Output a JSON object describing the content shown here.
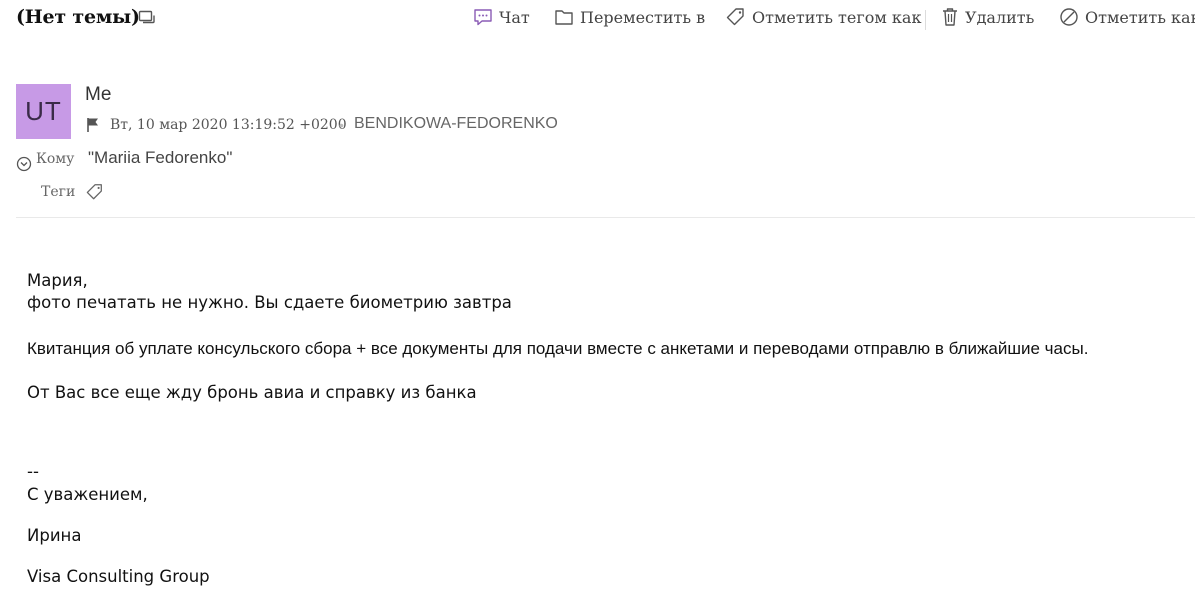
{
  "header": {
    "subject": "(Нет темы)",
    "thread_icon": "conversation-icon"
  },
  "toolbar": {
    "chat_label": "Чат",
    "move_label": "Переместить в",
    "tag_label": "Отметить тегом как",
    "delete_label": "Удалить",
    "mark_label": "Отметить как"
  },
  "message": {
    "avatar_initials": "UT",
    "avatar_color": "#c79ae6",
    "sender": "Me",
    "date": "Вт, 10 мар 2020 13:19:52 +0200",
    "separator": "•",
    "folder": "BENDIKOWA-FEDORENKO",
    "to_label": "Кому",
    "to_value": "\"Mariia Fedorenko\"",
    "tags_label": "Теги"
  },
  "body": {
    "line1": "Мария,",
    "line2": "фото печатать не нужно. Вы сдаете биометрию завтра",
    "line3": "Квитанция об уплате консульского сбора +  все документы для подачи вместе с анкетами и переводами отправлю в ближайшие часы.",
    "line4": "От Вас все еще жду бронь авиа и справку из банка",
    "sig_dash": "--",
    "sig_regards": "С уважением,",
    "sig_name": "Ирина",
    "sig_company": "Visa Consulting Group"
  }
}
